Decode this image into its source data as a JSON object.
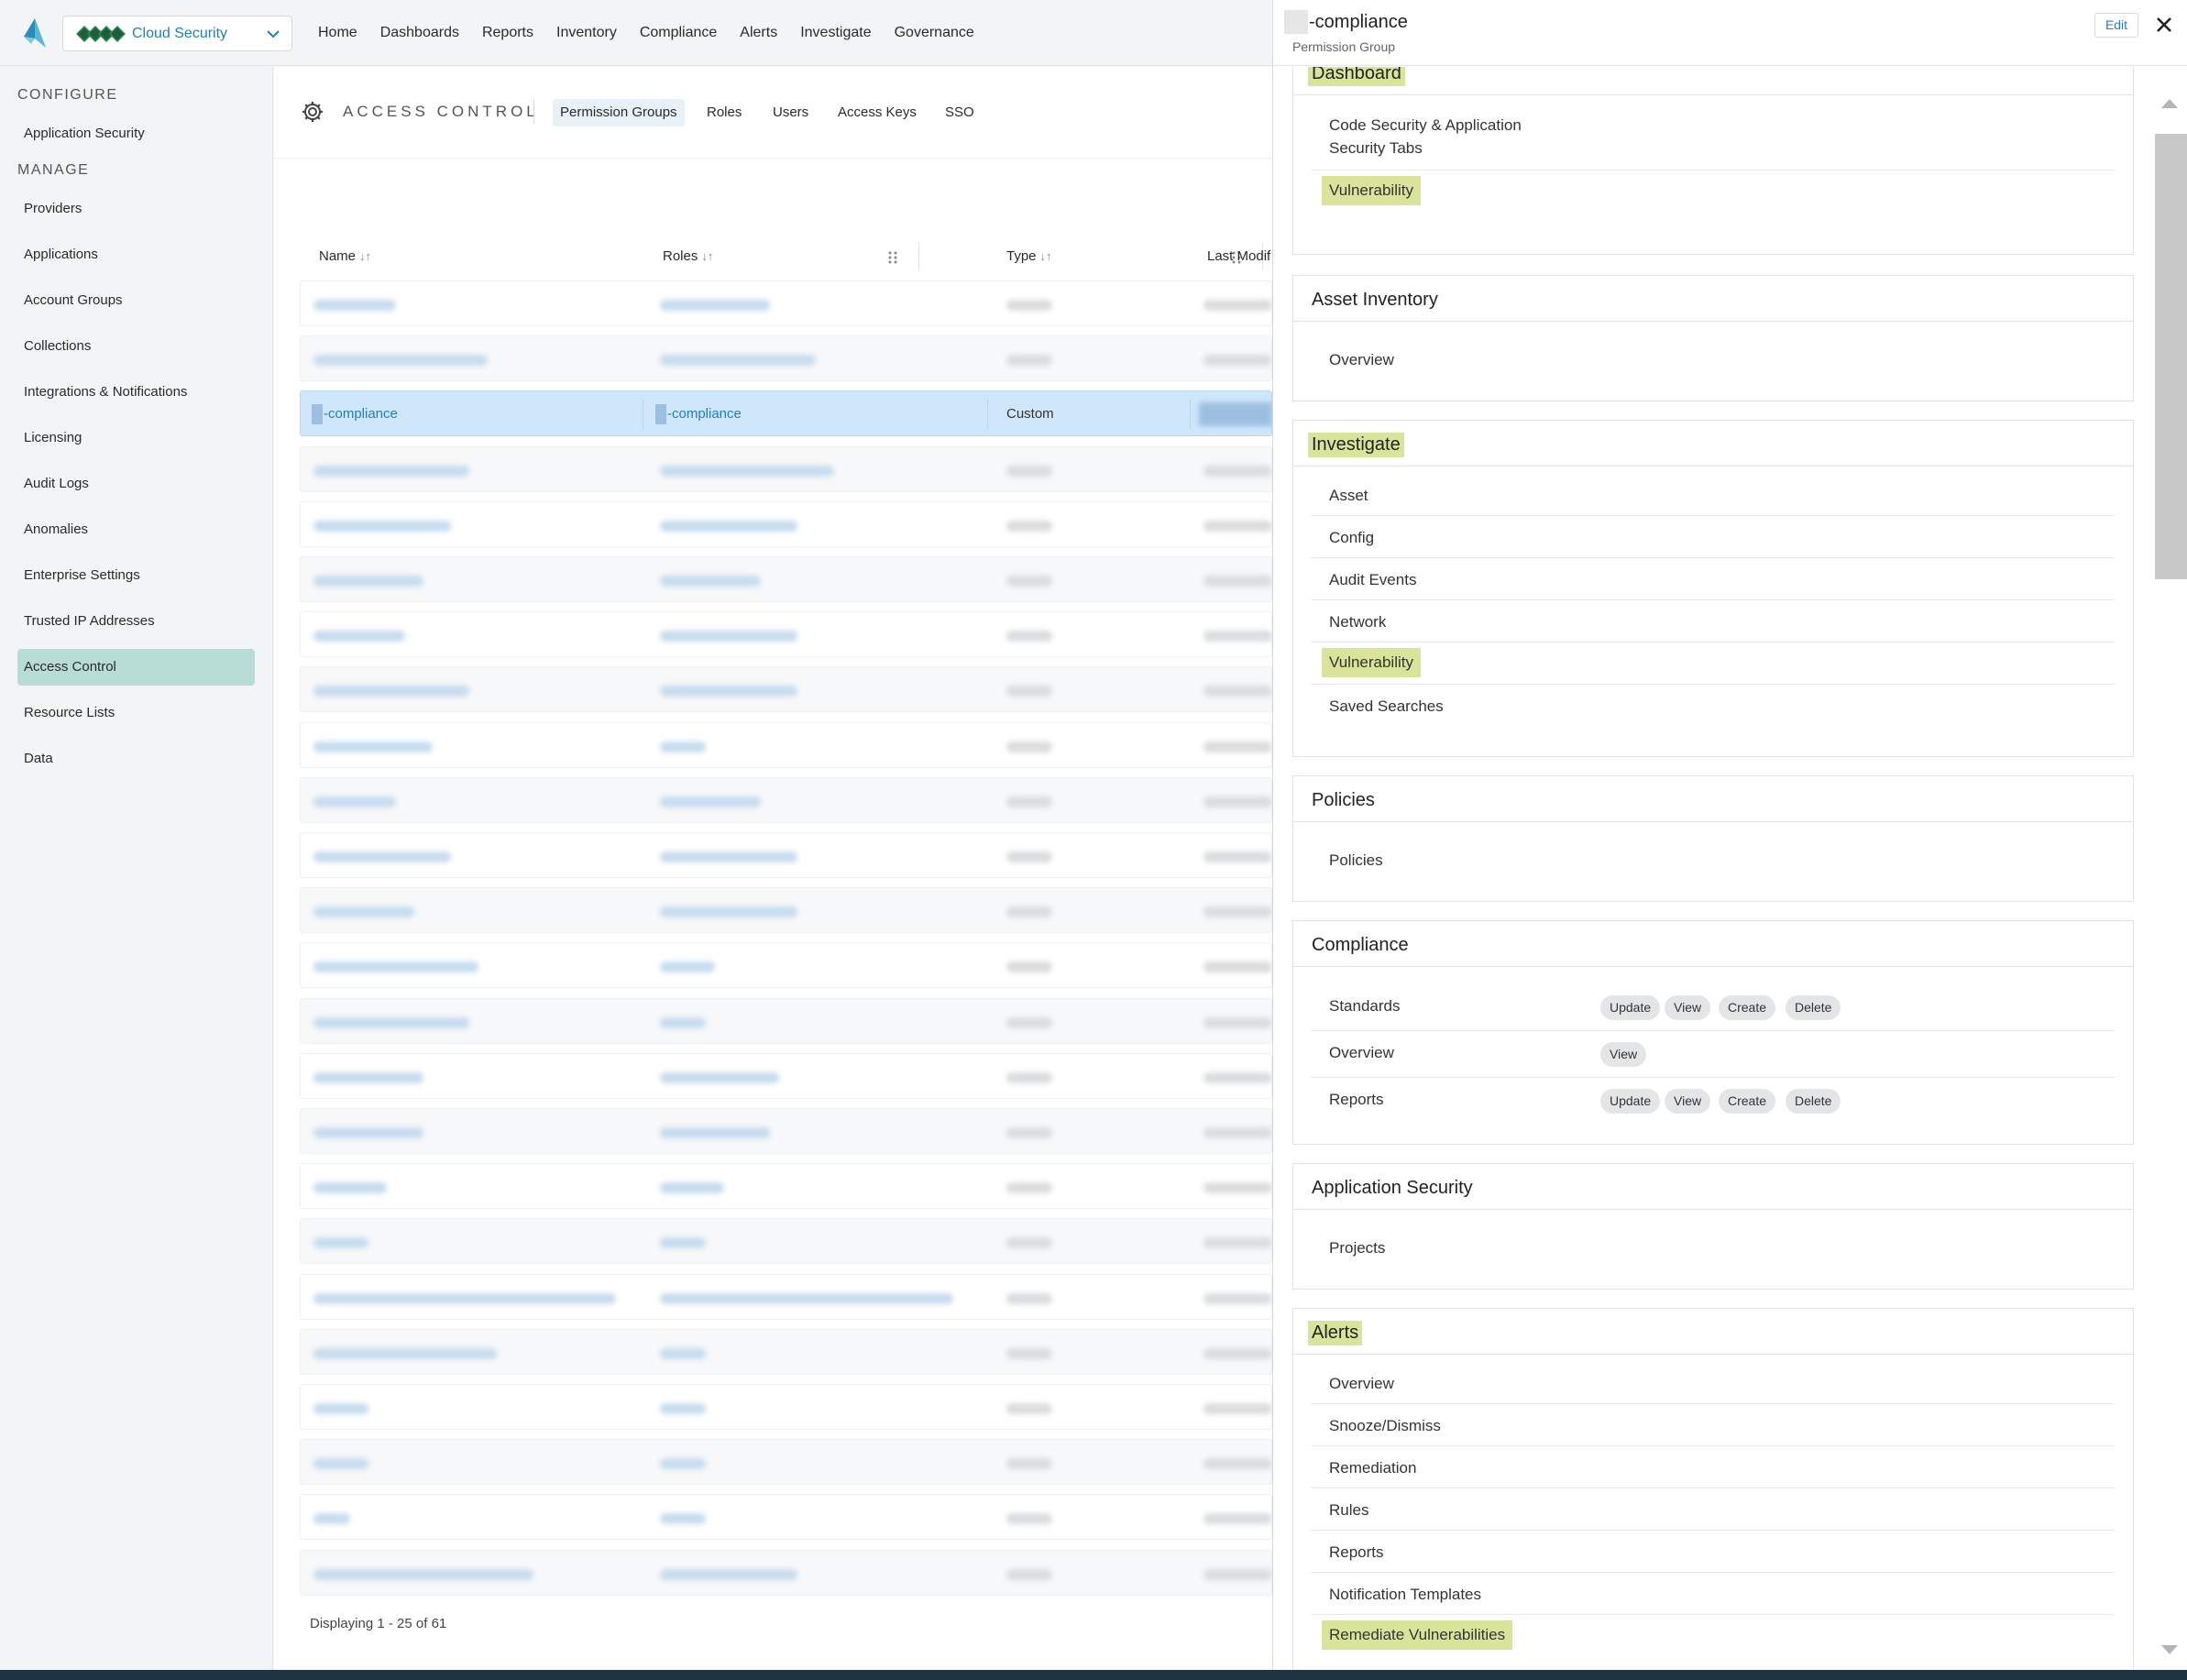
{
  "product": {
    "name": "Cloud Security"
  },
  "topnav": [
    "Home",
    "Dashboards",
    "Reports",
    "Inventory",
    "Compliance",
    "Alerts",
    "Investigate",
    "Governance"
  ],
  "sidebar": {
    "configure_heading": "CONFIGURE",
    "manage_heading": "MANAGE",
    "configure_items": [
      "Application Security"
    ],
    "manage_items": [
      "Providers",
      "Applications",
      "Account Groups",
      "Collections",
      "Integrations & Notifications",
      "Licensing",
      "Audit Logs",
      "Anomalies",
      "Enterprise Settings",
      "Trusted IP Addresses",
      "Access Control",
      "Resource Lists",
      "Data"
    ],
    "active_item": "Access Control"
  },
  "access_control": {
    "title": "ACCESS CONTROL",
    "tabs": [
      "Permission Groups",
      "Roles",
      "Users",
      "Access Keys",
      "SSO"
    ],
    "active_tab": "Permission Groups"
  },
  "table": {
    "columns": [
      "Name",
      "Roles",
      "Type",
      "Last Modif"
    ],
    "selected_row": {
      "name": "-compliance",
      "roles": "-compliance",
      "type": "Custom"
    },
    "footer": "Displaying 1 - 25 of 61"
  },
  "panel": {
    "title": "-compliance",
    "subtitle": "Permission Group",
    "edit_label": "Edit",
    "sections": {
      "dashboard": {
        "title": "Dashboard",
        "items": [
          "Code Security & Application Security Tabs",
          "Vulnerability"
        ]
      },
      "asset_inventory": {
        "title": "Asset Inventory",
        "items": [
          "Overview"
        ]
      },
      "investigate": {
        "title": "Investigate",
        "items": [
          "Asset",
          "Config",
          "Audit Events",
          "Network",
          "Vulnerability",
          "Saved Searches"
        ]
      },
      "policies": {
        "title": "Policies",
        "items": [
          "Policies"
        ]
      },
      "compliance": {
        "title": "Compliance",
        "items": [
          {
            "label": "Standards",
            "perms": [
              "Update",
              "View",
              "Create",
              "Delete"
            ]
          },
          {
            "label": "Overview",
            "perms": [
              "View"
            ]
          },
          {
            "label": "Reports",
            "perms": [
              "Update",
              "View",
              "Create",
              "Delete"
            ]
          }
        ]
      },
      "application_security": {
        "title": "Application Security",
        "items": [
          "Projects"
        ]
      },
      "alerts": {
        "title": "Alerts",
        "items": [
          "Overview",
          "Snooze/Dismiss",
          "Remediation",
          "Rules",
          "Reports",
          "Notification Templates",
          "Remediate Vulnerabilities"
        ]
      }
    }
  },
  "colors": {
    "accent": "#1d7fc1",
    "highlight": "#d9e49a",
    "active_nav": "#b8ddd6",
    "selected_row": "#cfe6fb"
  }
}
